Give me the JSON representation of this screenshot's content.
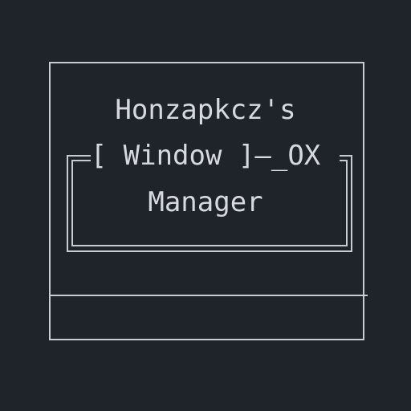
{
  "window": {
    "title_line_1": "Honzapkcz's",
    "title_line_2": "[ Window ]—_OX",
    "title_line_3": "Manager"
  },
  "colors": {
    "background": "#1f232a",
    "foreground": "#d6dade",
    "frame": "#c8ccd2"
  }
}
